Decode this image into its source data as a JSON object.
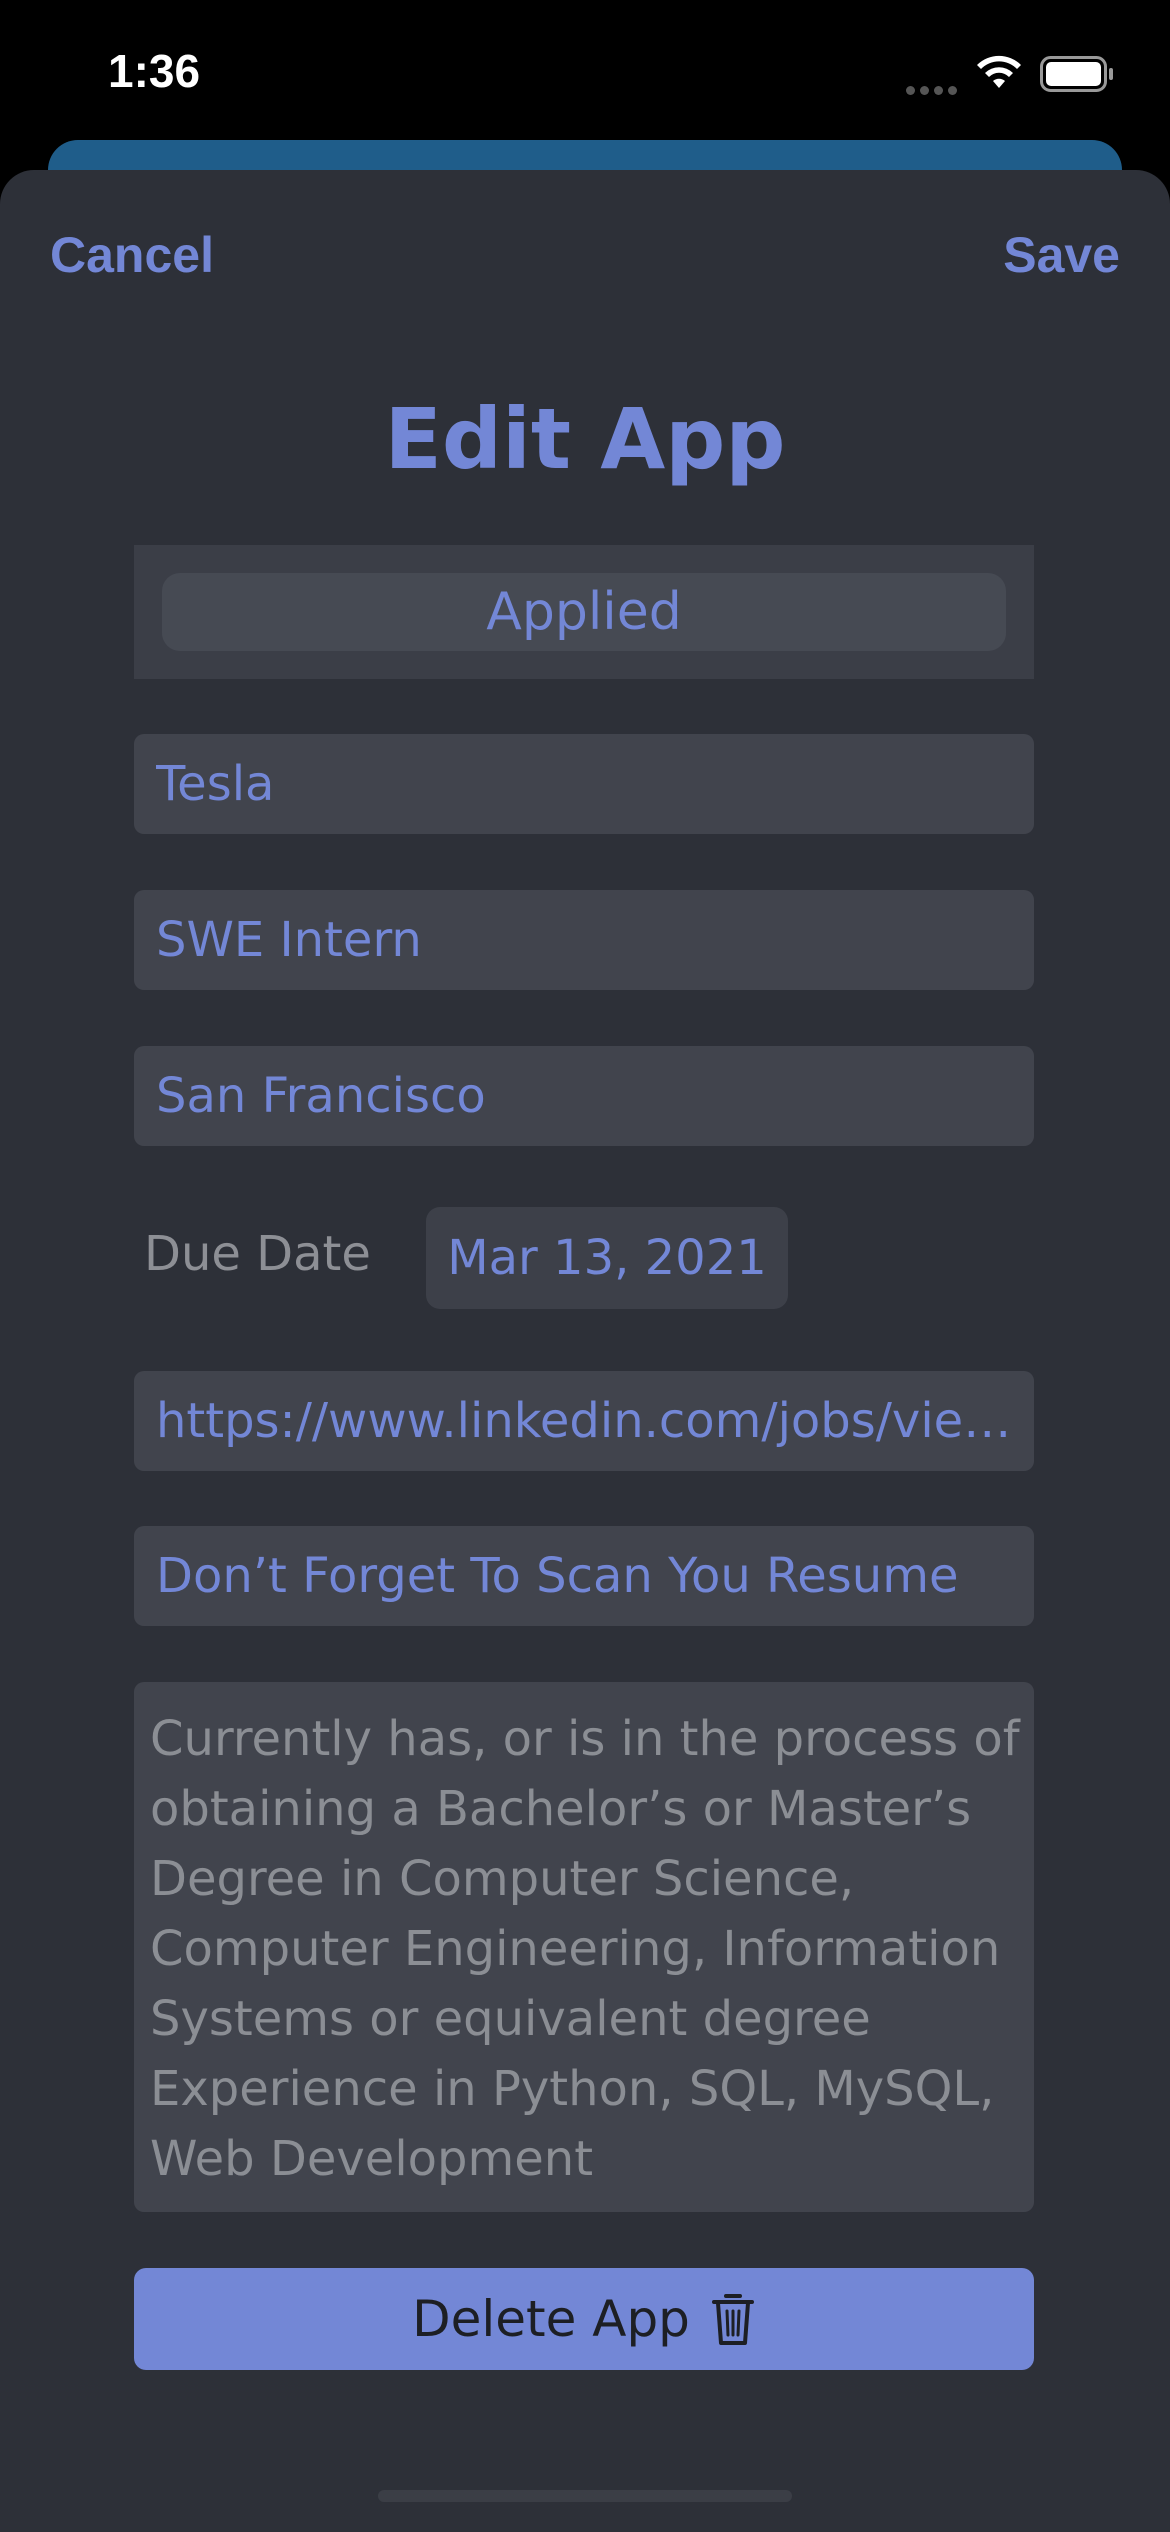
{
  "status_bar": {
    "time": "1:36",
    "icons": [
      "signal-dots-icon",
      "wifi-icon",
      "battery-icon"
    ]
  },
  "nav": {
    "cancel_label": "Cancel",
    "save_label": "Save"
  },
  "title": "Edit App",
  "status_picker": {
    "selected": "Applied"
  },
  "fields": {
    "company": "Tesla",
    "position": "SWE Intern",
    "location": "San Francisco",
    "link": "https://www.linkedin.com/jobs/vie…",
    "reminder": "Don’t Forget To Scan You Resume"
  },
  "due_date": {
    "label": "Due Date",
    "value": "Mar 13, 2021"
  },
  "notes": {
    "lines": [
      "Currently has, or is in the process of",
      "obtaining a Bachelor’s or Master’s",
      "Degree in Computer Science,",
      "Computer Engineering, Information",
      "Systems or equivalent degree",
      "Experience in Python, SQL, MySQL,",
      "Web Development"
    ]
  },
  "delete_button": {
    "label": "Delete App",
    "icon": "trash-icon"
  },
  "colors": {
    "accent": "#7387d6",
    "sheet_background": "#2d3038",
    "field_background": "#41444d",
    "placeholder_text": "#8b8e94",
    "behind_sheet": "#1f5d8a"
  }
}
